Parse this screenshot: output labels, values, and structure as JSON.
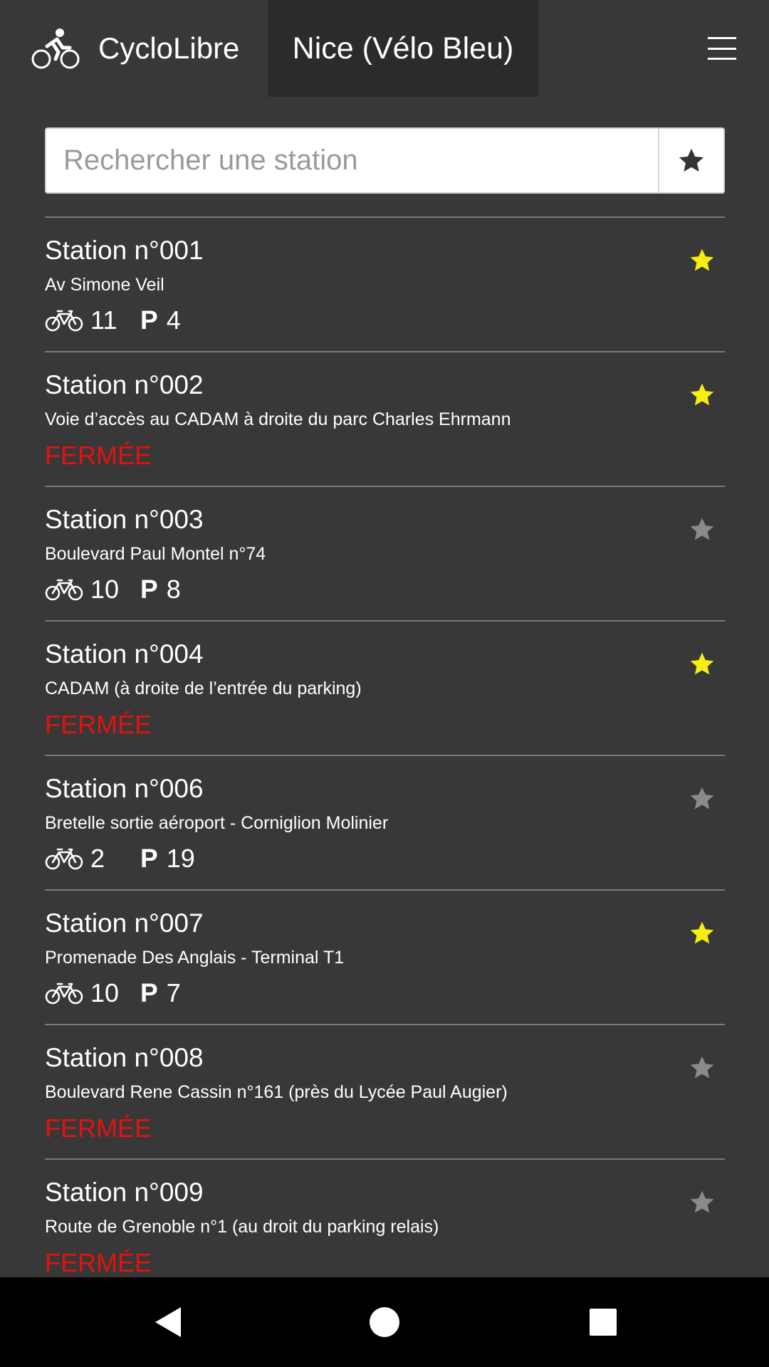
{
  "header": {
    "app_name": "CycloLibre",
    "city": "Nice (Vélo Bleu)"
  },
  "search": {
    "placeholder": "Rechercher une station",
    "value": ""
  },
  "colors": {
    "background": "#383838",
    "star_active": "#f5ef0f",
    "star_inactive": "#8a8a8a",
    "closed": "#e4120f"
  },
  "stations": [
    {
      "title": "Station n°001",
      "address": "Av Simone Veil",
      "closed": false,
      "bikes": "11",
      "parking_symbol": "P",
      "parking": "4",
      "favorite": true
    },
    {
      "title": "Station n°002",
      "address": "Voie d’accès au CADAM à droite du parc Charles Ehrmann",
      "closed": true,
      "status": "FERMÉE",
      "favorite": true
    },
    {
      "title": "Station n°003",
      "address": "Boulevard Paul Montel n°74",
      "closed": false,
      "bikes": "10",
      "parking_symbol": "P",
      "parking": "8",
      "favorite": false
    },
    {
      "title": "Station n°004",
      "address": "CADAM (à droite de l’entrée du parking)",
      "closed": true,
      "status": "FERMÉE",
      "favorite": true
    },
    {
      "title": "Station n°006",
      "address": "Bretelle sortie aéroport - Corniglion Molinier",
      "closed": false,
      "bikes": "2",
      "parking_symbol": "P",
      "parking": "19",
      "favorite": false
    },
    {
      "title": "Station n°007",
      "address": "Promenade Des Anglais - Terminal T1",
      "closed": false,
      "bikes": "10",
      "parking_symbol": "P",
      "parking": "7",
      "favorite": true
    },
    {
      "title": "Station n°008",
      "address": "Boulevard Rene Cassin n°161 (près du Lycée Paul Augier)",
      "closed": true,
      "status": "FERMÉE",
      "favorite": false
    },
    {
      "title": "Station n°009",
      "address": "Route de Grenoble n°1 (au droit du parking relais)",
      "closed": true,
      "status": "FERMÉE",
      "favorite": false
    }
  ],
  "navbar": {
    "buttons": [
      "back-icon",
      "home-icon",
      "recents-icon"
    ]
  }
}
